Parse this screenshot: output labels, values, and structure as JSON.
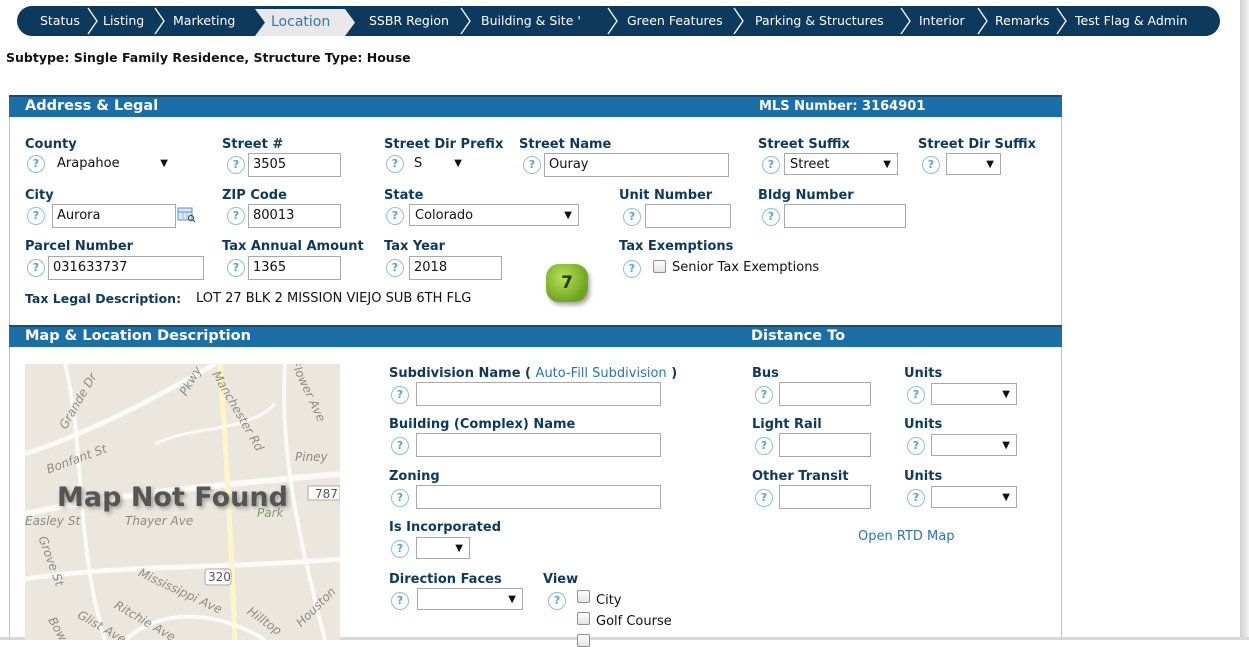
{
  "nav": {
    "tabs": [
      "Status",
      "Listing",
      "Marketing",
      "Location",
      "SSBR Region",
      "Building & Site '",
      "Green Features",
      "Parking & Structures",
      "Interior",
      "Remarks",
      "Test Flag & Admin"
    ],
    "active": "Location"
  },
  "subtype": "Subtype: Single Family Residence, Structure Type: House",
  "address": {
    "title": "Address & Legal",
    "mls": "MLS Number: 3164901",
    "county_label": "County",
    "county_value": "Arapahoe",
    "street_no_label": "Street #",
    "street_no_value": "3505",
    "dir_prefix_label": "Street Dir Prefix",
    "dir_prefix_value": "S",
    "street_name_label": "Street Name",
    "street_name_value": "Ouray",
    "suffix_label": "Street Suffix",
    "suffix_value": "Street",
    "dir_suffix_label": "Street Dir Suffix",
    "dir_suffix_value": "",
    "city_label": "City",
    "city_value": "Aurora",
    "zip_label": "ZIP Code",
    "zip_value": "80013",
    "state_label": "State",
    "state_value": "Colorado",
    "unit_label": "Unit Number",
    "unit_value": "",
    "bldg_label": "Bldg Number",
    "bldg_value": "",
    "parcel_label": "Parcel Number",
    "parcel_value": "031633737",
    "tax_amount_label": "Tax Annual Amount",
    "tax_amount_value": "1365",
    "tax_year_label": "Tax Year",
    "tax_year_value": "2018",
    "exemptions_label": "Tax Exemptions",
    "senior_label": "Senior Tax Exemptions",
    "legal_label": "Tax Legal Description:",
    "legal_value": "LOT 27 BLK 2 MISSION VIEJO SUB 6TH FLG",
    "badge": "7"
  },
  "map_section": {
    "title": "Map & Location Description",
    "distance_title": "Distance To",
    "map_message": "Map Not Found",
    "map_streets": [
      "Grande Dr",
      "Pkwy",
      "Manchester Rd",
      "Flower Ave",
      "Piney",
      "Bonfant St",
      "Thayer Ave",
      "Easley St",
      "Grove St",
      "Mississippi Ave",
      "Ritchie Ave",
      "Glist Ave",
      "Bow",
      "Hilltop",
      "Houston",
      "320",
      "787",
      "Park"
    ],
    "subdivision_label": "Subdivision Name (",
    "autofill_link": "Auto-Fill Subdivision",
    "subdivision_close": ")",
    "building_label": "Building (Complex) Name",
    "zoning_label": "Zoning",
    "incorporated_label": "Is Incorporated",
    "direction_label": "Direction Faces",
    "view_label": "View",
    "view_options": [
      "City",
      "Golf Course"
    ],
    "bus_label": "Bus",
    "light_rail_label": "Light Rail",
    "other_transit_label": "Other Transit",
    "units_label": "Units",
    "rtd_link": "Open RTD Map"
  }
}
